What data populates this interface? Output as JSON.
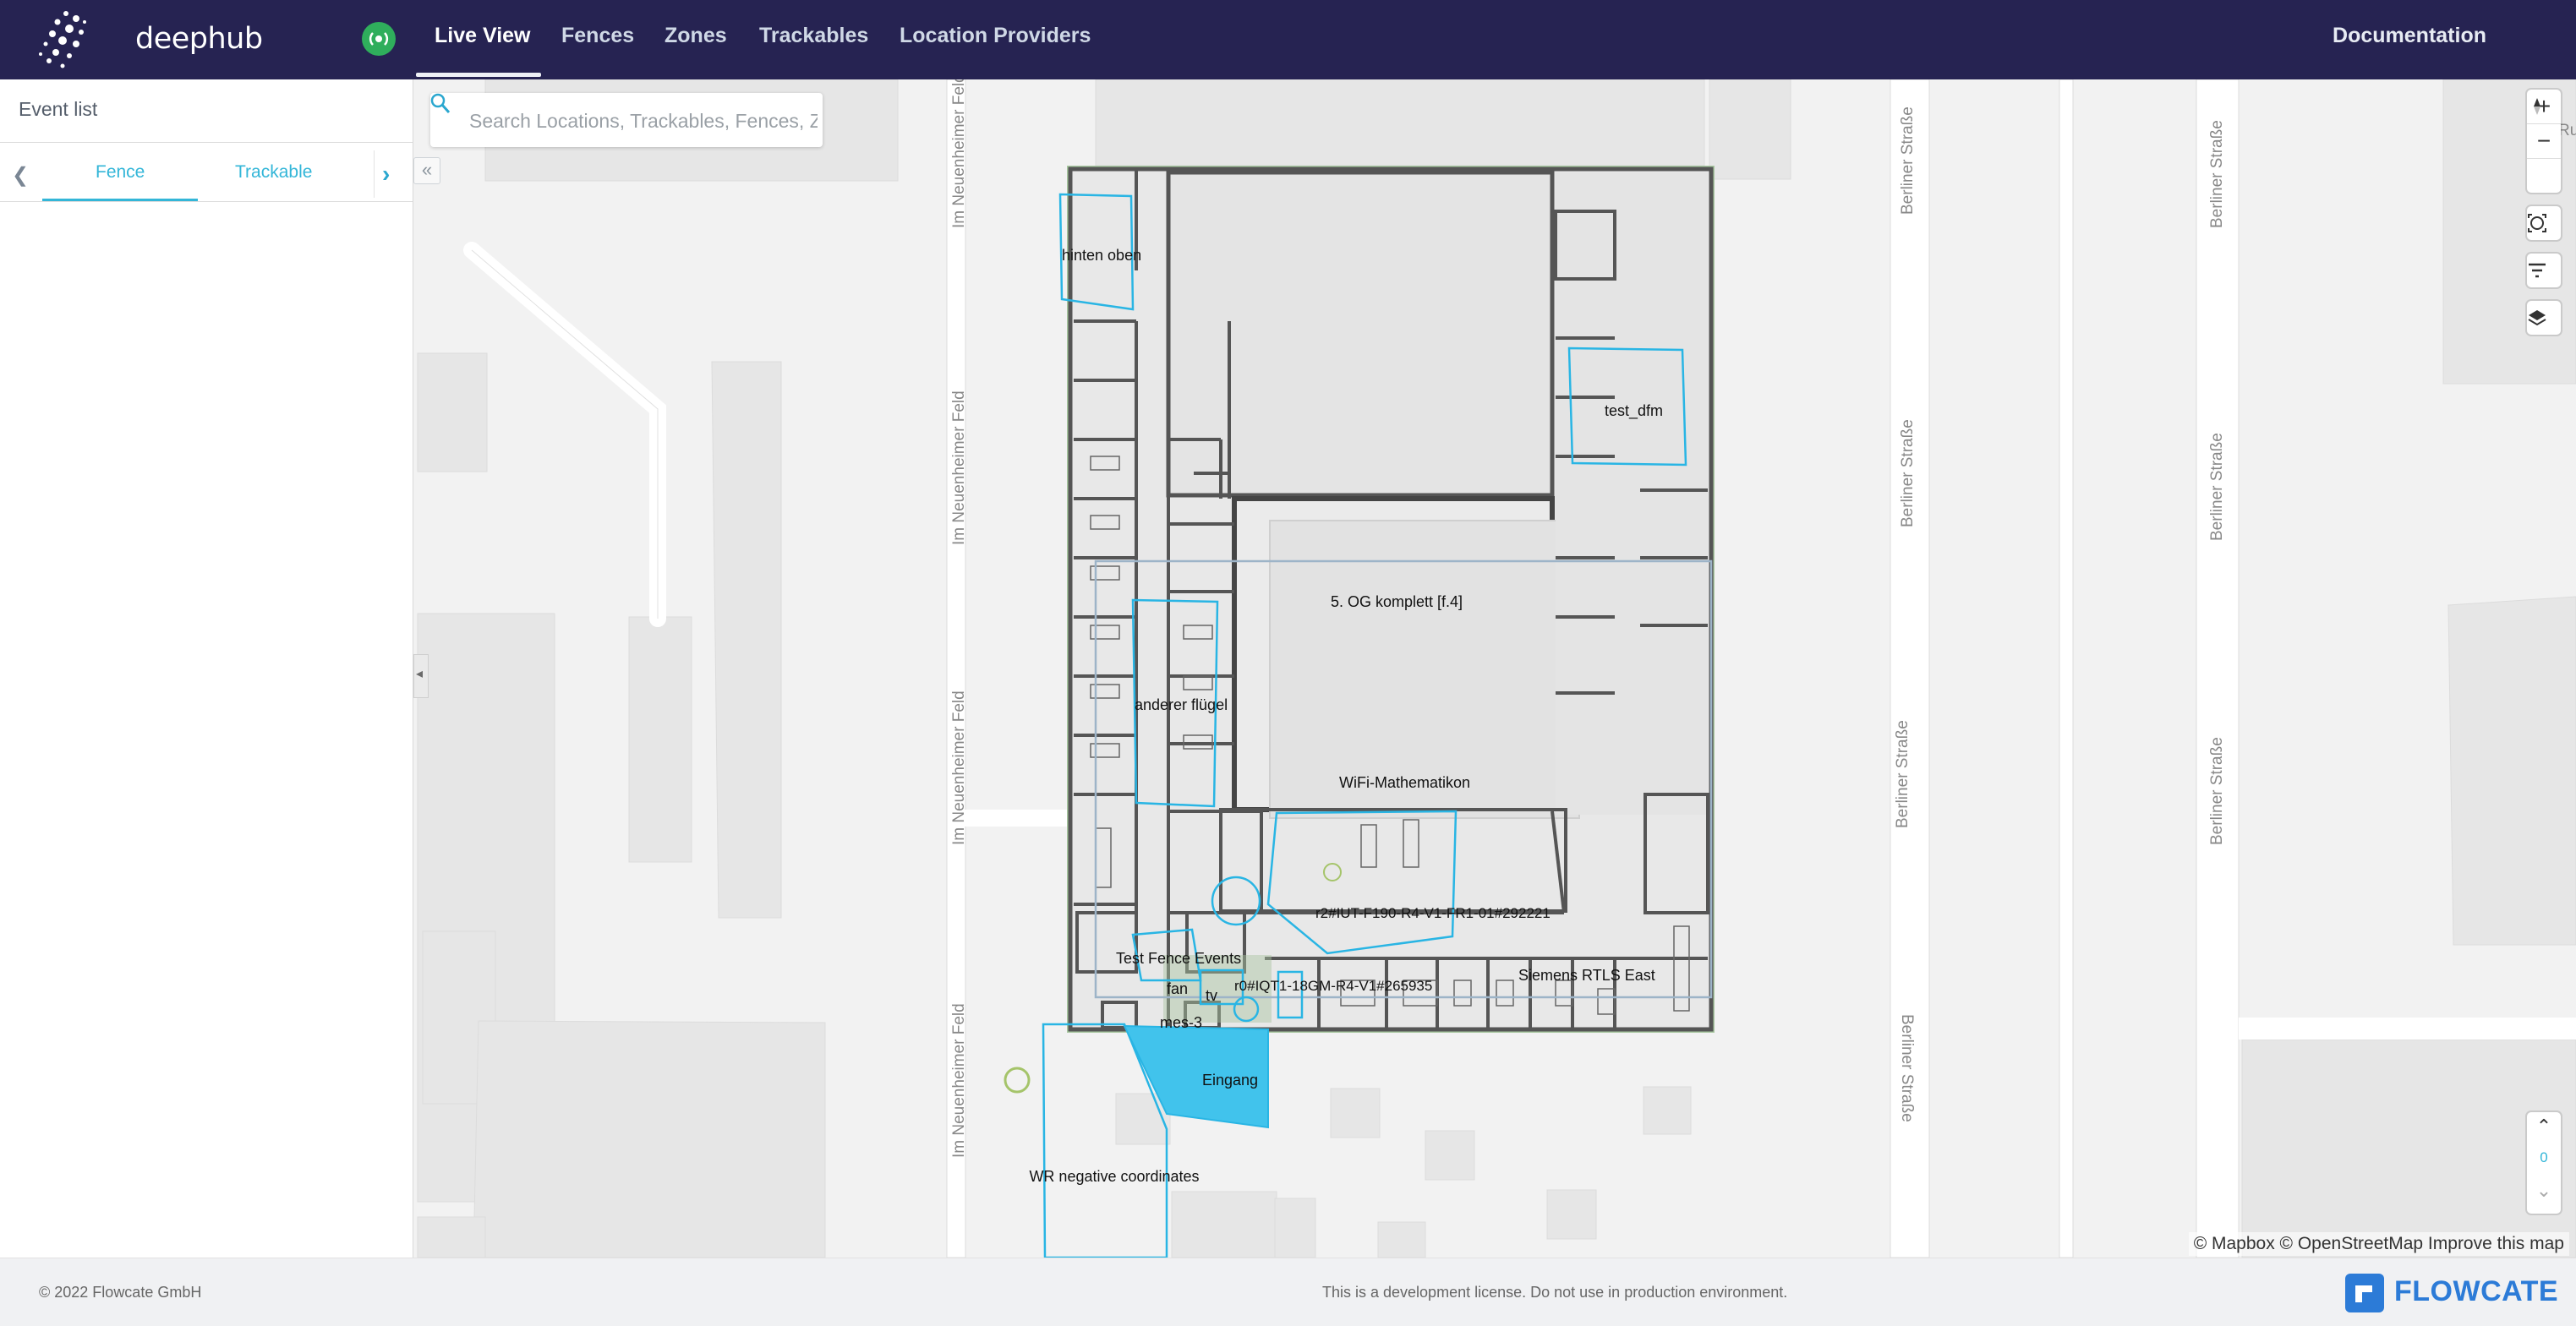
{
  "app": {
    "logo_text": "deephub",
    "nav": [
      {
        "label": "Live View",
        "active": true
      },
      {
        "label": "Fences",
        "active": false
      },
      {
        "label": "Zones",
        "active": false
      },
      {
        "label": "Trackables",
        "active": false
      },
      {
        "label": "Location Providers",
        "active": false
      }
    ],
    "documentation_label": "Documentation",
    "live_indicator_color": "#2fae5c",
    "topbar_color": "#262352"
  },
  "sidebar": {
    "title": "Event list",
    "tabs": [
      {
        "label": "Fence",
        "active": true
      },
      {
        "label": "Trackable",
        "active": false
      }
    ],
    "accent_color": "#33b6d8"
  },
  "map": {
    "search_placeholder": "Search Locations, Trackables, Fences, Zones",
    "collapse_icon": "double-chevron-left-icon",
    "streets": {
      "left": "Im Neuenheimer Feld",
      "right": "Berliner Straße",
      "far_right": "Berliner Straße",
      "corner_fragment": "Ru"
    },
    "fences": [
      "hinten oben",
      "test_dfm",
      "5. OG komplett [f.4]",
      "anderer flügel",
      "WiFi-Mathematikon",
      "r2#IUT-F190-R4-V1-FR1-01#292221",
      "Test Fence Events",
      "fan",
      "tv",
      "r0#IQT1-18GM-R4-V1#265935",
      "Siemens RTLS East",
      "mes-3",
      "Eingang",
      "WR negative coordinates"
    ],
    "zoom_level": "0",
    "attribution": "© Mapbox © OpenStreetMap Improve this map",
    "fence_color": "#29b5e4"
  },
  "footer": {
    "copyright": "© 2022 Flowcate GmbH",
    "license_note": "This is a development license. Do not use in production environment.",
    "brand": "FLOWCATE"
  }
}
